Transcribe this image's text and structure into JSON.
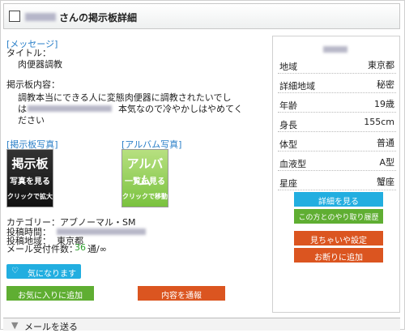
{
  "header": {
    "title": "さんの掲示板詳細"
  },
  "message": {
    "section_link": "[メッセージ]",
    "title_label": "タイトル：",
    "title_value": "肉便器調教",
    "body_label": "掲示板内容：",
    "body_line1": "調教本当にできる人に変態肉便器に調教されたいでし",
    "body_line2_prefix": "は",
    "body_line2_suffix": "本気なので冷やかしはやめてく",
    "body_line3": "ださい"
  },
  "photos": {
    "bbs_link": "[掲示板写真]",
    "album_link": "[アルバム写真]",
    "bbs_thumb": {
      "line1": "掲示板",
      "line2": "写真を見る",
      "line3": "クリックで拡大"
    },
    "album_thumb": {
      "line1": "アルバム",
      "line2": "一覧を見る",
      "line3": "クリックで移動"
    }
  },
  "meta": {
    "category": "カテゴリー：アブノーマル・SM",
    "posted_time_label": "投稿時間：",
    "posted_area_label": "投稿地域：",
    "posted_area_value": "東京都",
    "mail_count_label": "メール受付件数：",
    "mail_count_value": "36",
    "mail_count_suffix": "通/∞"
  },
  "actions": {
    "like_label": "気になります",
    "favorite_label": "お気に入りに追加",
    "report_label": "内容を通報"
  },
  "profile": {
    "rows": [
      {
        "key": "地域",
        "value": "東京都"
      },
      {
        "key": "詳細地域",
        "value": "秘密"
      },
      {
        "key": "年齢",
        "value": "19歳"
      },
      {
        "key": "身長",
        "value": "155cm"
      },
      {
        "key": "体型",
        "value": "普通"
      },
      {
        "key": "血液型",
        "value": "A型"
      },
      {
        "key": "星座",
        "value": "蟹座"
      }
    ],
    "details_button": "詳細を見る",
    "history_button": "この方とのやり取り履歴",
    "block_settings_button": "見ちゃいや設定",
    "refuse_button": "お断りに追加"
  },
  "footer": {
    "label": "メールを送る"
  }
}
